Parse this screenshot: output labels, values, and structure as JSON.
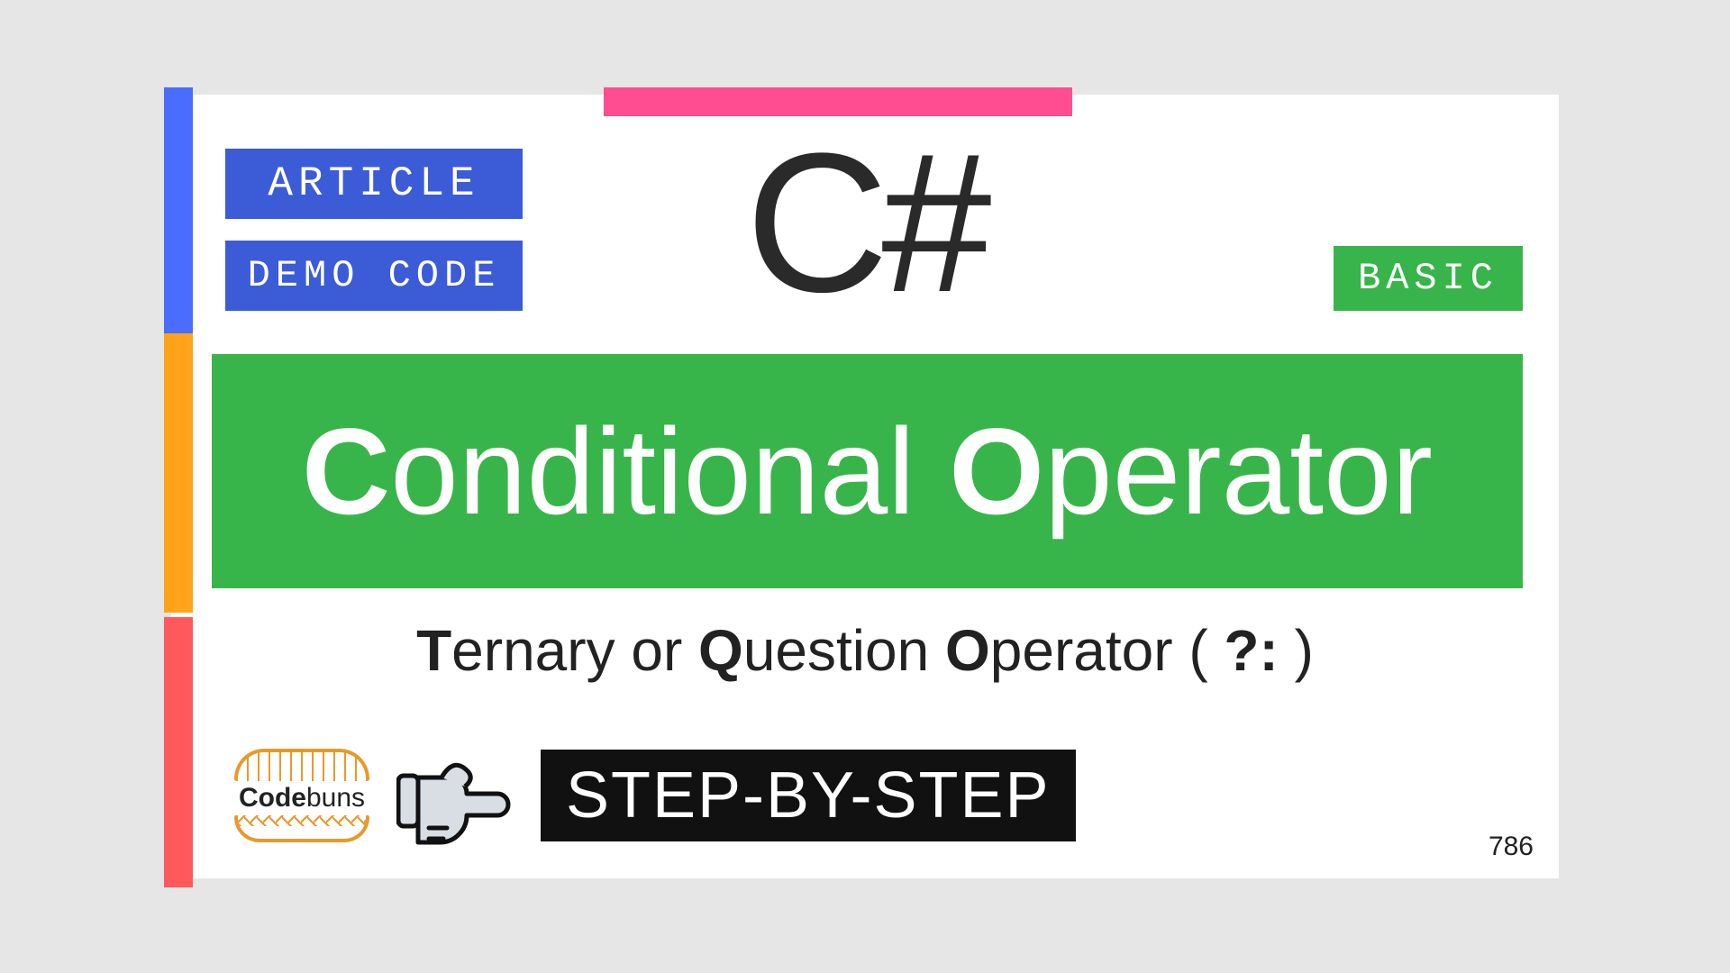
{
  "badges": {
    "article": "ARTICLE",
    "demo": "DEMO CODE",
    "basic": "BASIC"
  },
  "language": "C#",
  "title": {
    "C": "C",
    "onditional": "onditional ",
    "O": "O",
    "perator": "perator"
  },
  "subtitle": {
    "T": "T",
    "ernary_or": "ernary or ",
    "Q": "Q",
    "uestion": "uestion ",
    "O": "O",
    "perator_open": "perator ( ",
    "symbol": "?:",
    "close": " )"
  },
  "logo": {
    "bold": "Code",
    "rest": "buns"
  },
  "step": "STEP-BY-STEP",
  "corner_number": "786"
}
